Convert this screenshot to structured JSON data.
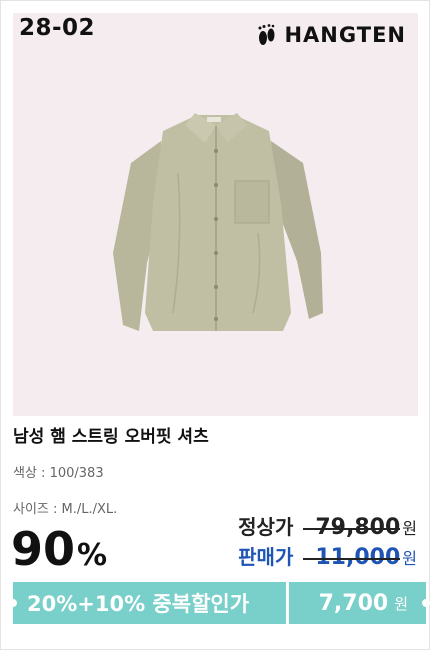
{
  "image": {
    "code_badge": "28-02",
    "brand_name": "HANGTEN",
    "background_color": "#f5ecef"
  },
  "product": {
    "name": "남성 햄 스트링 오버핏 셔츠",
    "color_label": "색상",
    "color_value": "100/383",
    "size_label": "사이즈",
    "size_value": "M./L./XL."
  },
  "pricing": {
    "discount_value": "90",
    "discount_unit": "%",
    "regular_label": "정상가",
    "regular_price": "79,800",
    "sale_label": "판매가",
    "sale_price": "11,000",
    "currency": "원"
  },
  "coupon": {
    "label": "20%+10% 중복할인가",
    "final_price": "7,700",
    "currency": "원",
    "color": "#79cfc9"
  },
  "colors": {
    "sale_blue": "#1e55b5",
    "text_dark": "#111111"
  }
}
